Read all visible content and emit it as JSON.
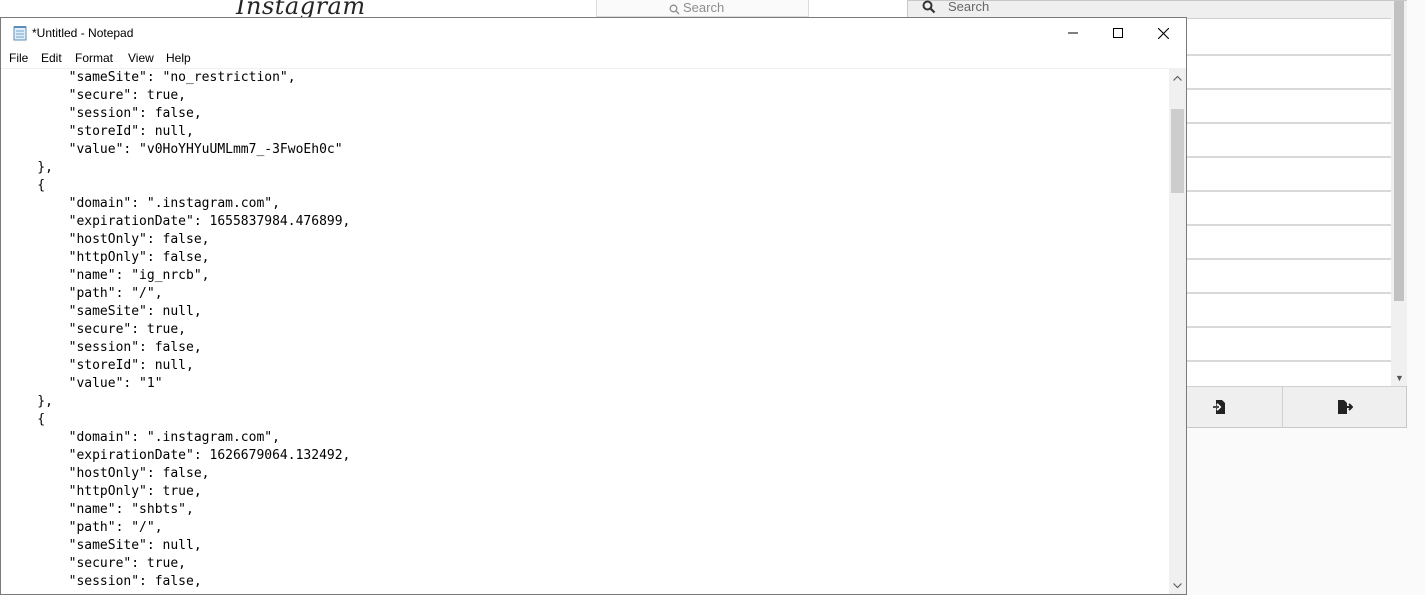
{
  "background_page": {
    "logo_text": "Instagram",
    "search_placeholder": "Search"
  },
  "extension_panel": {
    "search_placeholder": "Search",
    "row_count": 10,
    "import_icon": "import-file-icon",
    "export_icon": "export-file-icon"
  },
  "notepad": {
    "title": "*Untitled - Notepad",
    "app_icon": "notepad-icon",
    "window_buttons": [
      "minimize-icon",
      "maximize-icon",
      "close-icon"
    ],
    "menu": [
      "File",
      "Edit",
      "Format",
      "View",
      "Help"
    ],
    "lines": [
      "        \"sameSite\": \"no_restriction\",",
      "        \"secure\": true,",
      "        \"session\": false,",
      "        \"storeId\": null,",
      "        \"value\": \"v0HoYHYuUMLmm7_-3FwoEh0c\"",
      "    },",
      "    {",
      "        \"domain\": \".instagram.com\",",
      "        \"expirationDate\": 1655837984.476899,",
      "        \"hostOnly\": false,",
      "        \"httpOnly\": false,",
      "        \"name\": \"ig_nrcb\",",
      "        \"path\": \"/\",",
      "        \"sameSite\": null,",
      "        \"secure\": true,",
      "        \"session\": false,",
      "        \"storeId\": null,",
      "        \"value\": \"1\"",
      "    },",
      "    {",
      "        \"domain\": \".instagram.com\",",
      "        \"expirationDate\": 1626679064.132492,",
      "        \"hostOnly\": false,",
      "        \"httpOnly\": true,",
      "        \"name\": \"shbts\",",
      "        \"path\": \"/\",",
      "        \"sameSite\": null,",
      "        \"secure\": true,",
      "        \"session\": false,"
    ]
  },
  "colors": {
    "window_border": "#7a7a7a",
    "scrollbar_track": "#f0f0f0",
    "scrollbar_thumb": "#cdcdcd"
  }
}
